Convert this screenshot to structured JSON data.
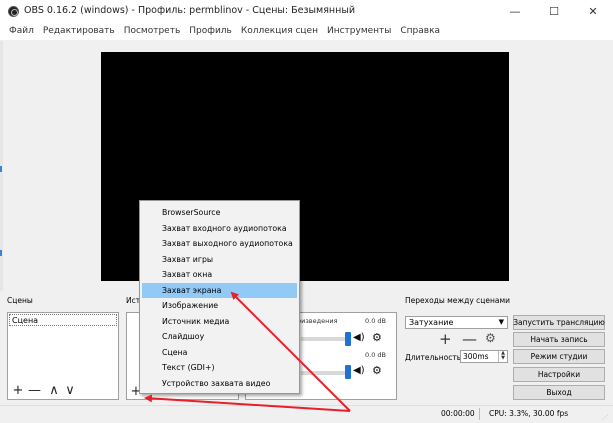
{
  "window": {
    "title": "OBS 0.16.2 (windows) - Профиль: permblinov - Сцены: Безымянный",
    "minimize_glyph": "—",
    "maximize_glyph": "☐",
    "close_glyph": "✕"
  },
  "menubar": {
    "items": [
      "Файл",
      "Редактировать",
      "Посмотреть",
      "Профиль",
      "Коллекция сцен",
      "Инструменты",
      "Справка"
    ]
  },
  "scenes": {
    "label": "Сцены",
    "items": [
      "Сцена"
    ],
    "add_glyph": "+",
    "remove_glyph": "—",
    "up_glyph": "∧",
    "down_glyph": "∨"
  },
  "sources": {
    "label": "Ист",
    "add_glyph": "+"
  },
  "mixer": {
    "channels": [
      {
        "name": "роизведения",
        "db": "0.0 dB"
      },
      {
        "name": "",
        "db": "0.0 dB"
      }
    ],
    "volume_glyph": "◀)",
    "gear_glyph": "⚙"
  },
  "transitions": {
    "label": "Переходы между сценами",
    "selected": "Затухание",
    "caret": "▼",
    "add_glyph": "+",
    "remove_glyph": "—",
    "gear_glyph": "⚙",
    "duration_label": "Длительность",
    "duration_value": "300ms",
    "spin_up": "▲",
    "spin_down": "▼"
  },
  "controls": {
    "start_stream": "Запустить трансляцию",
    "start_record": "Начать запись",
    "studio_mode": "Режим студии",
    "settings": "Настройки",
    "exit": "Выход"
  },
  "status": {
    "time": "00:00:00",
    "cpu": "CPU: 3.3%, 30.00 fps",
    "grip": "⋰"
  },
  "context_menu": {
    "items": [
      "BrowserSource",
      "Захват входного аудиопотока",
      "Захват выходного аудиопотока",
      "Захват игры",
      "Захват окна",
      "Захват экрана",
      "Изображение",
      "Источник медиа",
      "Слайдшоу",
      "Сцена",
      "Текст (GDI+)",
      "Устройство захвата видео"
    ],
    "highlighted": "Захват экрана"
  },
  "colors": {
    "preview": "#000000",
    "highlight": "#91c9f7",
    "annotation_arrow": "#e8202a",
    "slider_handle": "#1e72d6"
  }
}
